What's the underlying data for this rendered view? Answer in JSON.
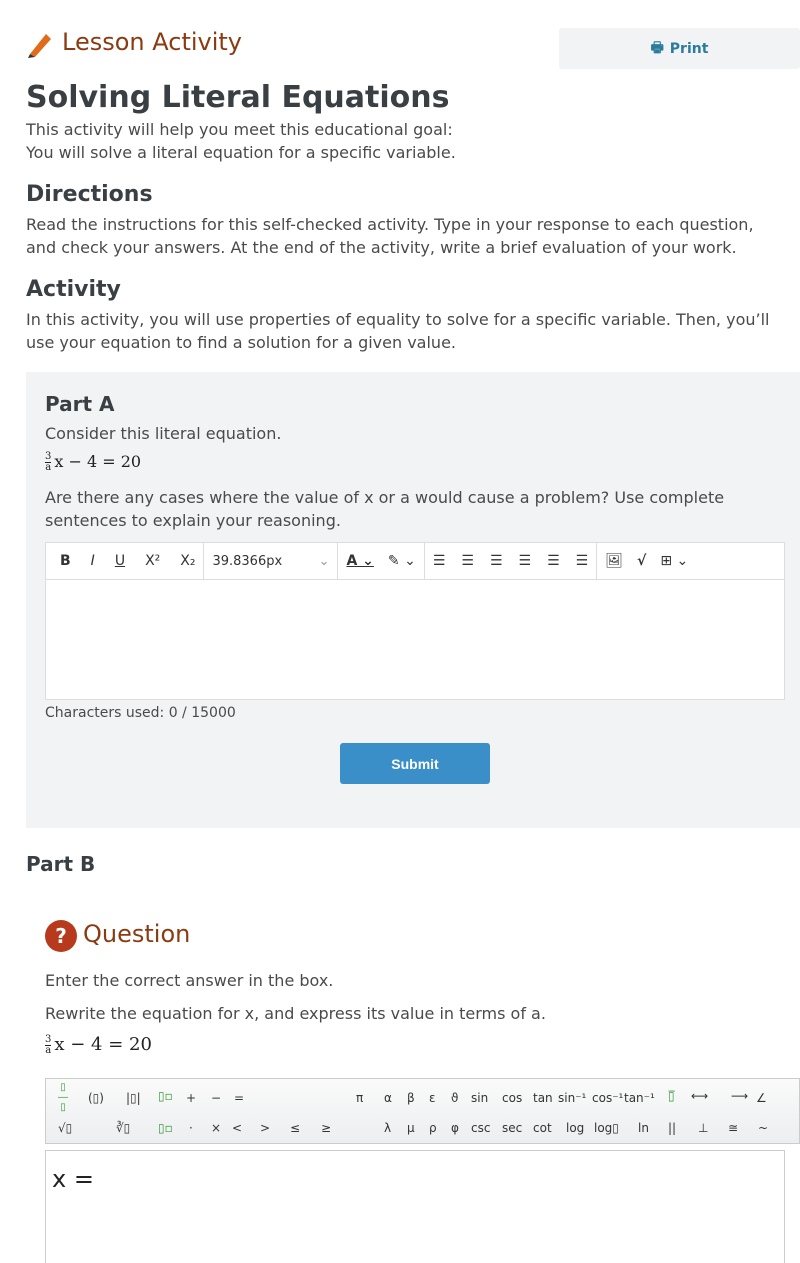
{
  "header": {
    "title": "Lesson Activity",
    "print_label": "Print",
    "icon": "pencil-icon"
  },
  "page_title": "Solving Literal Equations",
  "intro": [
    "This activity will help you meet this educational goal:",
    "You will solve a literal equation for a specific variable."
  ],
  "directions": {
    "heading": "Directions",
    "text": "Read the instructions for this self-checked activity. Type in your response to each question, and check your answers. At the end of the activity, write a brief evaluation of your work."
  },
  "activity": {
    "heading": "Activity",
    "text": "In this activity, you will use properties of equality to solve for a specific variable. Then, you’ll use your equation to find a solution for a given value."
  },
  "part_a": {
    "heading": "Part A",
    "prompt": "Consider this literal equation.",
    "eq_num": "3",
    "eq_den": "a",
    "eq_rest": "x − 4 = 20",
    "question": "Are there any cases where the value of x or a would cause a problem? Use complete sentences to explain your reasoning.",
    "toolbar": {
      "bold": "B",
      "italic": "I",
      "underline": "U",
      "superscript": "X²",
      "subscript": "X₂",
      "font_size": "39.8366px"
    },
    "char_count": "Characters used: 0 / 15000",
    "submit_label": "Submit"
  },
  "part_b": {
    "heading": "Part B",
    "question_label": "Question",
    "instruction": "Enter the correct answer in the box.",
    "prompt": "Rewrite the equation for x, and express its value in terms of a.",
    "eq_num": "3",
    "eq_den": "a",
    "eq_rest": "x − 4 = 20",
    "answer_prefix": "x =",
    "math_toolbar": {
      "row1": [
        "(▯)",
        "|▯|",
        "+",
        "−",
        "=",
        "π",
        "α",
        "β",
        "ε",
        "ϑ",
        "sin",
        "cos",
        "tan",
        "sin⁻¹",
        "cos⁻¹",
        "tan⁻¹",
        "∠"
      ],
      "row2": [
        "·",
        "×",
        "<",
        ">",
        "≤",
        "≥",
        "λ",
        "μ",
        "ρ",
        "φ",
        "csc",
        "sec",
        "cot",
        "log",
        "log▯",
        "ln",
        "||",
        "⊥",
        "≅",
        "~"
      ]
    }
  }
}
